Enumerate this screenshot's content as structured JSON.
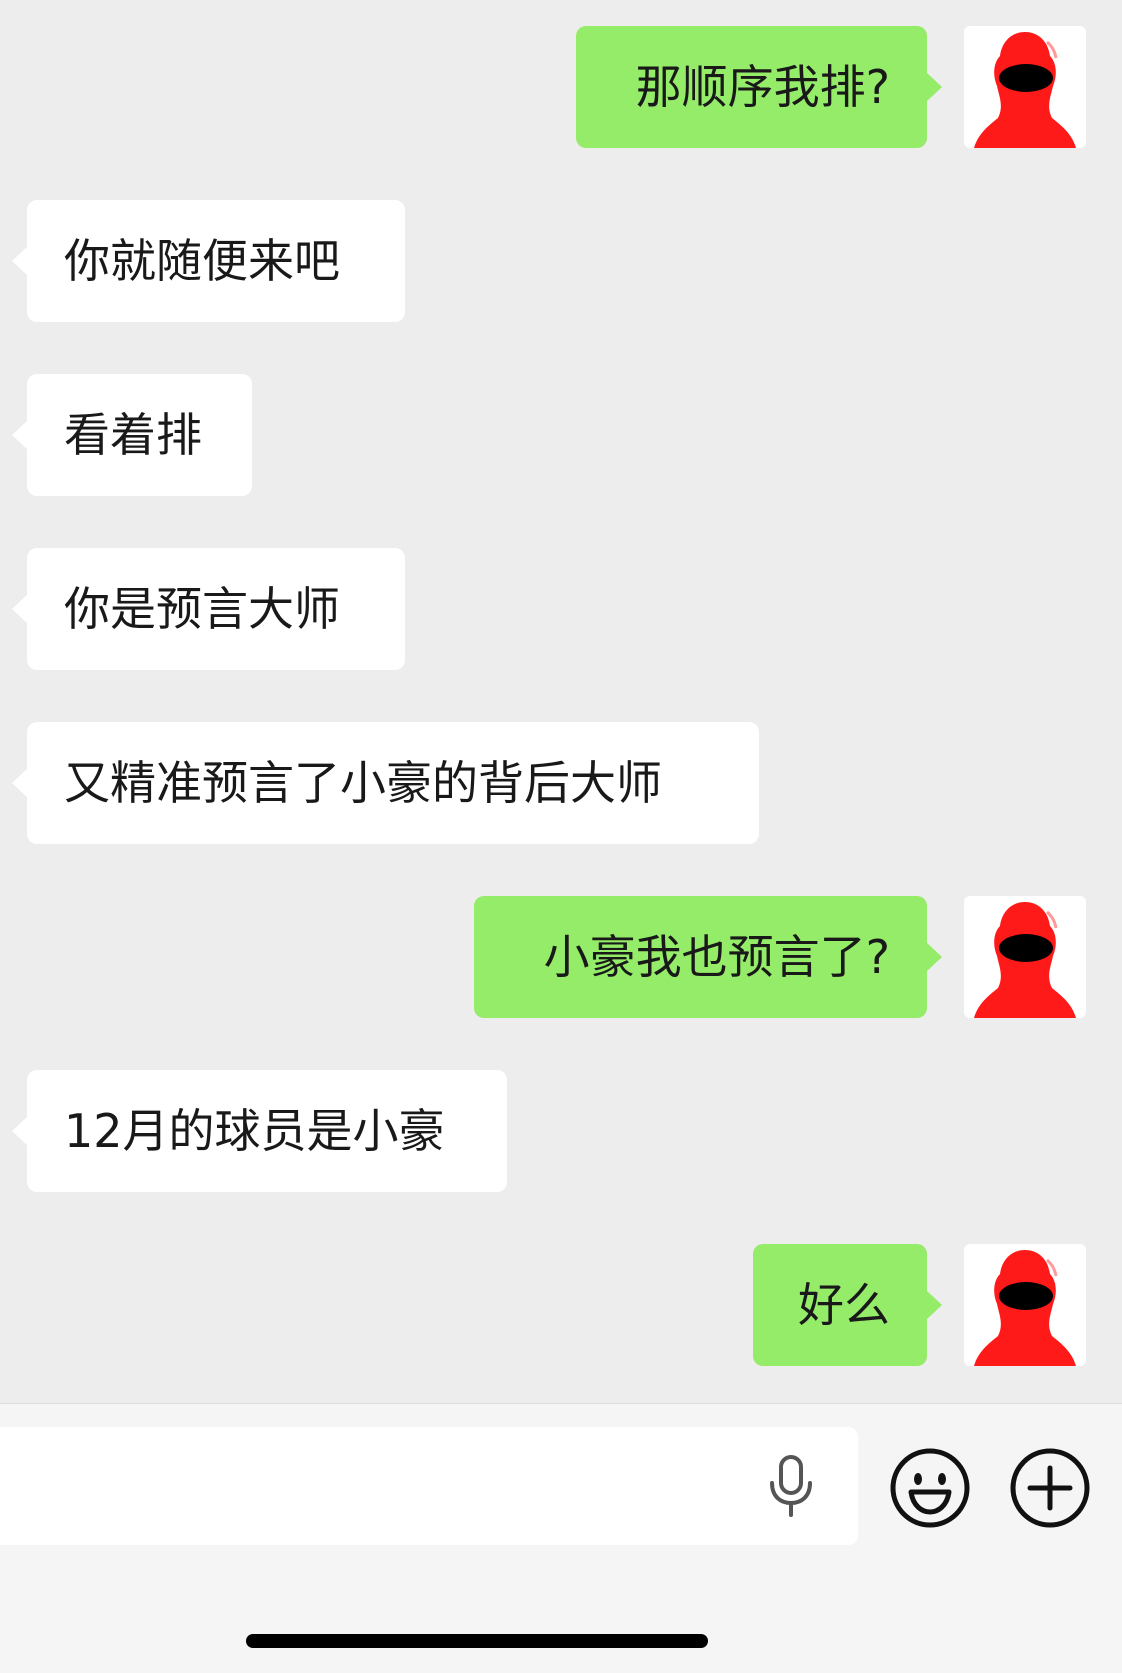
{
  "messages": [
    {
      "side": "out",
      "text": "那顺序我排?"
    },
    {
      "side": "in",
      "text": "你就随便来吧"
    },
    {
      "side": "in",
      "text": "看着排"
    },
    {
      "side": "in",
      "text": "你是预言大师"
    },
    {
      "side": "in",
      "text": "又精准预言了小豪的背后大师"
    },
    {
      "side": "out",
      "text": "小豪我也预言了?"
    },
    {
      "side": "in",
      "text": "12月的球员是小豪"
    },
    {
      "side": "out",
      "text": "好么"
    }
  ],
  "colors": {
    "background": "#ededed",
    "incoming_bubble": "#ffffff",
    "outgoing_bubble": "#95ec69",
    "avatar_figure": "#ff1a1a",
    "input_bar": "#f5f5f5"
  },
  "input_bar": {
    "icons": [
      "microphone-icon",
      "emoji-icon",
      "plus-icon"
    ]
  }
}
